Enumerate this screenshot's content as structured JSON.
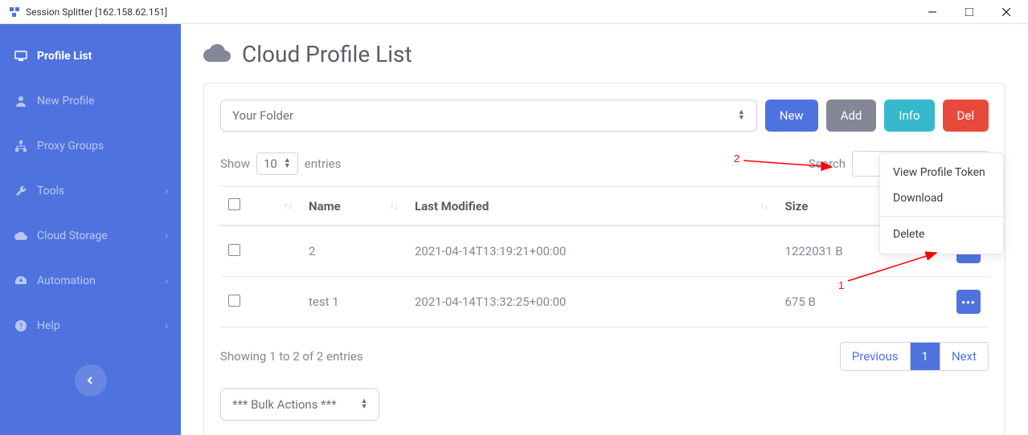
{
  "window": {
    "title": "Session Splitter [162.158.62.151]"
  },
  "sidebar": {
    "items": [
      {
        "label": "Profile List",
        "icon": "monitor",
        "active": true
      },
      {
        "label": "New Profile",
        "icon": "user"
      },
      {
        "label": "Proxy Groups",
        "icon": "sitemap"
      },
      {
        "label": "Tools",
        "icon": "wrench",
        "chevron": true
      },
      {
        "label": "Cloud Storage",
        "icon": "cloud",
        "chevron": true
      },
      {
        "label": "Automation",
        "icon": "tachometer",
        "chevron": true
      },
      {
        "label": "Help",
        "icon": "question",
        "chevron": true
      }
    ]
  },
  "page": {
    "title": "Cloud Profile List"
  },
  "toolbar": {
    "folder": "Your Folder",
    "new_label": "New",
    "add_label": "Add",
    "info_label": "Info",
    "del_label": "Del"
  },
  "table": {
    "show_label": "Show",
    "entries_value": "10",
    "entries_label": "entries",
    "search_label": "Search",
    "headers": {
      "name": "Name",
      "last_modified": "Last Modified",
      "size": "Size"
    },
    "rows": [
      {
        "name": "2",
        "last_modified": "2021-04-14T13:19:21+00:00",
        "size": "1222031 B"
      },
      {
        "name": "test 1",
        "last_modified": "2021-04-14T13:32:25+00:00",
        "size": "675 B"
      }
    ],
    "footer_text": "Showing 1 to 2 of 2 entries",
    "previous": "Previous",
    "page": "1",
    "next": "Next"
  },
  "bulk_actions": {
    "label": "*** Bulk Actions ***"
  },
  "context_menu": {
    "view_token": "View Profile Token",
    "download": "Download",
    "delete": "Delete"
  },
  "annotations": {
    "one": "1",
    "two": "2"
  }
}
